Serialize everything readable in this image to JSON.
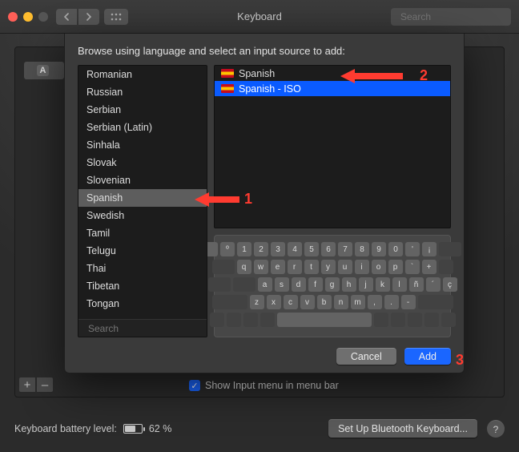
{
  "window": {
    "title": "Keyboard",
    "search_placeholder": "Search"
  },
  "sheet": {
    "instruction": "Browse using language and select an input source to add:",
    "lang_search_placeholder": "Search",
    "cancel": "Cancel",
    "add": "Add",
    "languages": [
      "Romanian",
      "Russian",
      "Serbian",
      "Serbian (Latin)",
      "Sinhala",
      "Slovak",
      "Slovenian",
      "Spanish",
      "Swedish",
      "Tamil",
      "Telugu",
      "Thai",
      "Tibetan",
      "Tongan"
    ],
    "selected_language_index": 7,
    "sources": [
      {
        "label": "Spanish",
        "flag": "es"
      },
      {
        "label": "Spanish - ISO",
        "flag": "es"
      }
    ],
    "selected_source_index": 1,
    "keyboard_rows": [
      [
        "º",
        "1",
        "2",
        "3",
        "4",
        "5",
        "6",
        "7",
        "8",
        "9",
        "0",
        "'",
        "¡"
      ],
      [
        "q",
        "w",
        "e",
        "r",
        "t",
        "y",
        "u",
        "i",
        "o",
        "p",
        "`",
        "+"
      ],
      [
        "a",
        "s",
        "d",
        "f",
        "g",
        "h",
        "j",
        "k",
        "l",
        "ñ",
        "´",
        "ç"
      ],
      [
        "z",
        "x",
        "c",
        "v",
        "b",
        "n",
        "m",
        ",",
        ".",
        "-"
      ]
    ]
  },
  "behind": {
    "show_input_menu": "Show Input menu in menu bar",
    "battery_label": "Keyboard battery level:",
    "battery_pct": "62 %",
    "setup_bt": "Set Up Bluetooth Keyboard..."
  },
  "annotation": {
    "n1": "1",
    "n2": "2",
    "n3": "3"
  }
}
